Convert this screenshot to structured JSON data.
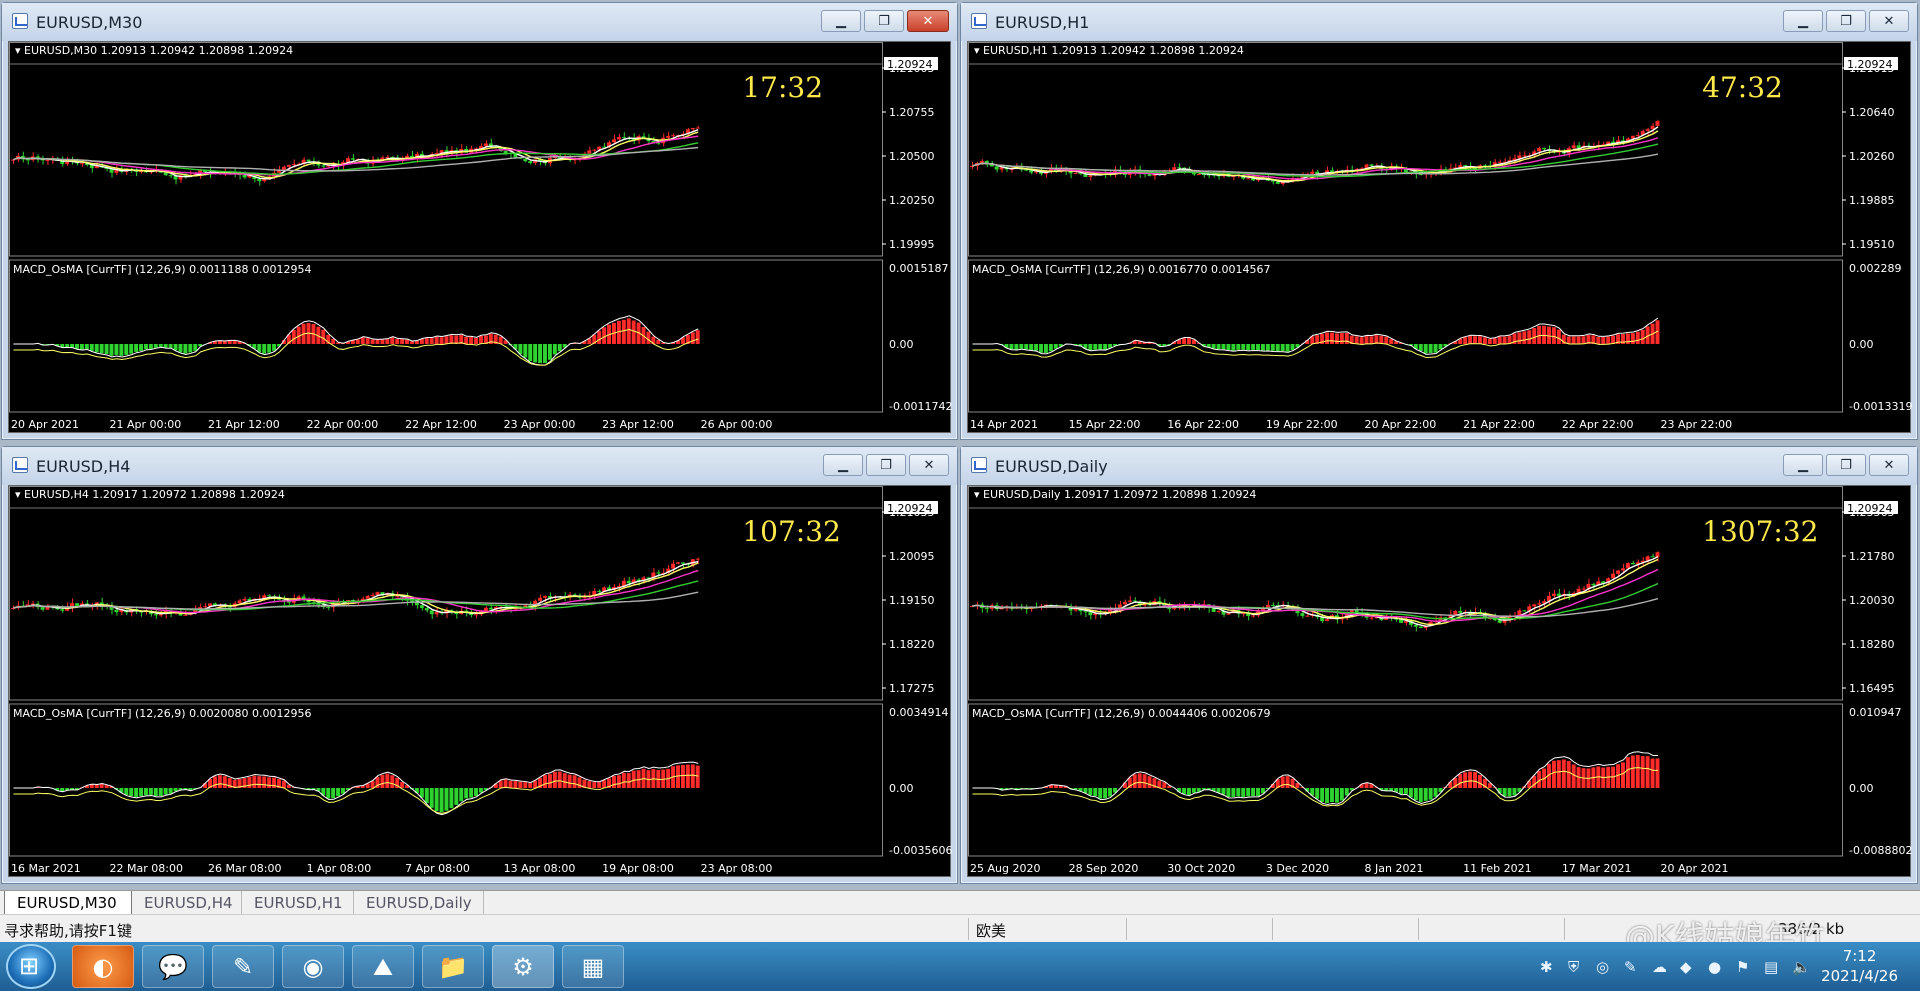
{
  "colors": {
    "bull": "#ff2a2a",
    "bear": "#2fd32f",
    "white": "#ffffff",
    "yellow": "#ffff66",
    "magenta": "#ff33cc",
    "green": "#33cc33",
    "gray": "#b0b0b0",
    "timer": "#ffe94a",
    "axis": "#ffffff"
  },
  "windows": [
    {
      "title": "EURUSD,M30",
      "close_active": true,
      "chart_label": "EURUSD,M30  1.20913 1.20942 1.20898 1.20924",
      "timer": "17:32",
      "current_price": "1.20924",
      "price_ticks": [
        "1.21005",
        "1.20755",
        "1.20500",
        "1.20250",
        "1.19995"
      ],
      "macd_label": "MACD_OsMA [CurrTF] (12,26,9) 0.0011188 0.0012954",
      "macd_ticks": [
        "0.0015187",
        "0.00",
        "-0.0011742"
      ],
      "date_ticks": [
        "20 Apr 2021",
        "21 Apr 00:00",
        "21 Apr 12:00",
        "22 Apr 00:00",
        "22 Apr 12:00",
        "23 Apr 00:00",
        "23 Apr 12:00",
        "26 Apr 00:00"
      ]
    },
    {
      "title": "EURUSD,H1",
      "close_active": false,
      "chart_label": "EURUSD,H1  1.20913 1.20942 1.20898 1.20924",
      "timer": "47:32",
      "current_price": "1.20924",
      "price_ticks": [
        "1.21015",
        "1.20640",
        "1.20260",
        "1.19885",
        "1.19510"
      ],
      "macd_label": "MACD_OsMA [CurrTF] (12,26,9) 0.0016770 0.0014567",
      "macd_ticks": [
        "0.002289",
        "0.00",
        "-0.0013319"
      ],
      "date_ticks": [
        "14 Apr 2021",
        "15 Apr 22:00",
        "16 Apr 22:00",
        "19 Apr 22:00",
        "20 Apr 22:00",
        "21 Apr 22:00",
        "22 Apr 22:00",
        "23 Apr 22:00"
      ]
    },
    {
      "title": "EURUSD,H4",
      "close_active": false,
      "chart_label": "EURUSD,H4  1.20917 1.20972 1.20898 1.20924",
      "timer": "107:32",
      "current_price": "1.20924",
      "price_ticks": [
        "1.21035",
        "1.20095",
        "1.19150",
        "1.18220",
        "1.17275"
      ],
      "macd_label": "MACD_OsMA [CurrTF] (12,26,9) 0.0020080 0.0012956",
      "macd_ticks": [
        "0.0034914",
        "0.00",
        "-0.0035606"
      ],
      "date_ticks": [
        "16 Mar 2021",
        "22 Mar 08:00",
        "26 Mar 08:00",
        "1 Apr 08:00",
        "7 Apr 08:00",
        "13 Apr 08:00",
        "19 Apr 08:00",
        "23 Apr 08:00"
      ]
    },
    {
      "title": "EURUSD,Daily",
      "close_active": false,
      "chart_label": "EURUSD,Daily  1.20917 1.20972 1.20898 1.20924",
      "timer": "1307:32",
      "current_price": "1.20924",
      "price_ticks": [
        "1.23565",
        "1.21780",
        "1.20030",
        "1.18280",
        "1.16495"
      ],
      "macd_label": "MACD_OsMA [CurrTF] (12,26,9) 0.0044406 0.0020679",
      "macd_ticks": [
        "0.010947",
        "0.00",
        "-0.0088802"
      ],
      "date_ticks": [
        "25 Aug 2020",
        "28 Sep 2020",
        "30 Oct 2020",
        "3 Dec 2020",
        "8 Jan 2021",
        "11 Feb 2021",
        "17 Mar 2021",
        "20 Apr 2021"
      ]
    }
  ],
  "tabs": [
    "EURUSD,M30",
    "EURUSD,H4",
    "EURUSD,H1",
    "EURUSD,Daily"
  ],
  "status": {
    "help": "寻求帮助,请按F1键",
    "lang": "欧美",
    "extra": "386/2 kb"
  },
  "watermark": "@K线姑娘年竹",
  "clock": {
    "time": "7:12",
    "date": "2021/4/26"
  }
}
